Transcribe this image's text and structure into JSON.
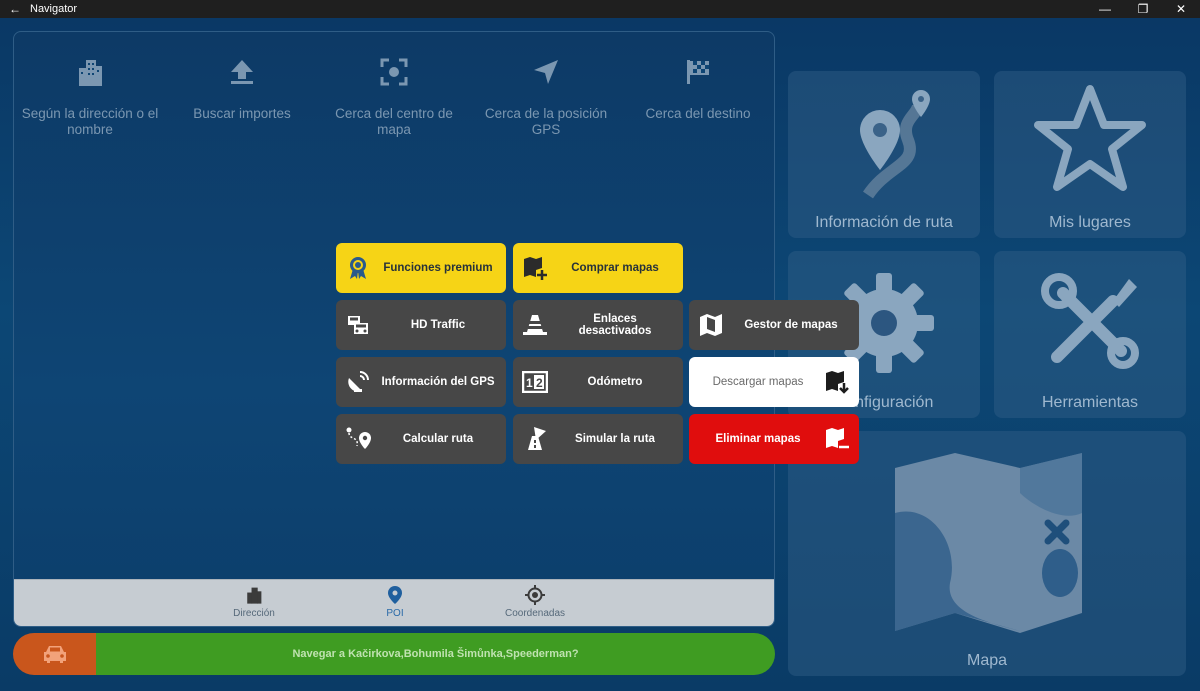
{
  "window": {
    "title": "Navigator",
    "back_glyph": "←",
    "controls": {
      "minimize": "—",
      "maximize": "❐",
      "close": "✕"
    }
  },
  "panel": {
    "categories": [
      {
        "label": "Según la dirección o el nombre",
        "icon": "buildings-icon"
      },
      {
        "label": "Buscar importes",
        "icon": "upload-arrow-icon"
      },
      {
        "label": "Cerca del centro de mapa",
        "icon": "map-center-icon"
      },
      {
        "label": "Cerca de la posición GPS",
        "icon": "gps-arrow-icon"
      },
      {
        "label": "Cerca del destino",
        "icon": "checkered-flag-icon"
      }
    ],
    "bottom_tabs": [
      {
        "label": "Dirección",
        "icon": "buildings-icon",
        "active": false
      },
      {
        "label": "POI",
        "icon": "pin-icon",
        "active": true
      },
      {
        "label": "Coordenadas",
        "icon": "crosshair-icon",
        "active": false
      }
    ]
  },
  "nav_bar": {
    "destination": "Navegar a Kačirkova,Bohumila Šimůnka,Speederman?",
    "icon": "car-icon"
  },
  "tiles": [
    {
      "label": "Información de ruta",
      "icon": "route-icon"
    },
    {
      "label": "Mis lugares",
      "icon": "star-icon"
    },
    {
      "label": "Configuración",
      "icon": "gear-icon"
    },
    {
      "label": "Herramientas",
      "icon": "tools-icon"
    },
    {
      "label": "Mapa",
      "icon": "map-icon"
    }
  ],
  "menu": {
    "premium": "Funciones premium",
    "buy_maps": "Comprar mapas",
    "hd_traffic": "HD Traffic",
    "disabled_links": "Enlaces desactivados",
    "map_manager": "Gestor de mapas",
    "gps_info": "Información del GPS",
    "odometer": "Odómetro",
    "download_maps": "Descargar mapas",
    "calc_route": "Calcular ruta",
    "simulate_route": "Simular la ruta",
    "delete_maps": "Eliminar mapas"
  },
  "colors": {
    "yellow": "#f6d416",
    "dark_button": "#474747",
    "red": "#e00d0d",
    "nav_green": "#3f9c22",
    "nav_orange": "#c9561c"
  }
}
